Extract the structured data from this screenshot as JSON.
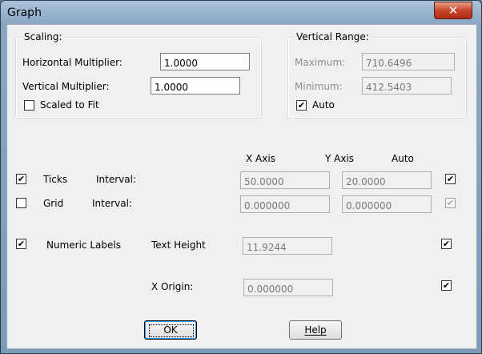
{
  "window": {
    "title": "Graph",
    "close_glyph": "✕"
  },
  "scaling": {
    "legend": "Scaling:",
    "horizontal_label": "Horizontal Multiplier:",
    "horizontal_value": "1.0000",
    "vertical_label": "Vertical Multiplier:",
    "vertical_value": "1.0000",
    "scaled_to_fit_label": "Scaled to Fit",
    "scaled_to_fit_checked": false
  },
  "vertical_range": {
    "legend": "Vertical Range:",
    "maximum_label": "Maximum:",
    "maximum_value": "710.6496",
    "minimum_label": "Minimum:",
    "minimum_value": "412.5403",
    "auto_label": "Auto",
    "auto_checked": true
  },
  "columns": {
    "x_axis": "X Axis",
    "y_axis": "Y Axis",
    "auto": "Auto"
  },
  "ticks": {
    "checked": true,
    "label": "Ticks",
    "interval_label": "Interval:",
    "x_value": "50.0000",
    "y_value": "20.0000",
    "auto_checked": true
  },
  "grid": {
    "checked": false,
    "label": "Grid",
    "interval_label": "Interval:",
    "x_value": "0.000000",
    "y_value": "0.000000",
    "auto_checked": true,
    "auto_disabled": true
  },
  "numeric_labels": {
    "checked": true,
    "label": "Numeric Labels",
    "text_height_label": "Text Height",
    "text_height_value": "11.9244",
    "auto_checked": true
  },
  "x_origin": {
    "label": "X Origin:",
    "value": "0.000000",
    "auto_checked": true
  },
  "buttons": {
    "ok": "OK",
    "help": "Help"
  },
  "check_glyph": "✔"
}
